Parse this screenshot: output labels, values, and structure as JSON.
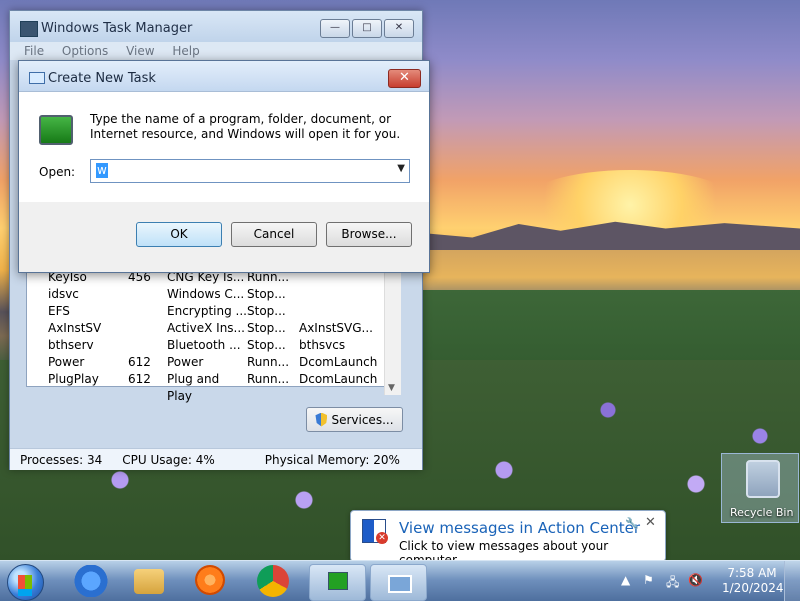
{
  "task_manager": {
    "title": "Windows Task Manager",
    "menu": [
      "File",
      "Options",
      "View",
      "Help"
    ],
    "rows": [
      {
        "name": "KeyIso",
        "pid": "456",
        "description": "CNG Key Is...",
        "status": "Runn...",
        "group": ""
      },
      {
        "name": "idsvc",
        "pid": "",
        "description": "Windows C...",
        "status": "Stop...",
        "group": ""
      },
      {
        "name": "EFS",
        "pid": "",
        "description": "Encrypting ...",
        "status": "Stop...",
        "group": ""
      },
      {
        "name": "AxInstSV",
        "pid": "",
        "description": "ActiveX Ins...",
        "status": "Stop...",
        "group": "AxInstSVG..."
      },
      {
        "name": "bthserv",
        "pid": "",
        "description": "Bluetooth ...",
        "status": "Stop...",
        "group": "bthsvcs"
      },
      {
        "name": "Power",
        "pid": "612",
        "description": "Power",
        "status": "Runn...",
        "group": "DcomLaunch"
      },
      {
        "name": "PlugPlay",
        "pid": "612",
        "description": "Plug and Play",
        "status": "Runn...",
        "group": "DcomLaunch"
      }
    ],
    "services_button": "Services...",
    "status": {
      "processes": "Processes: 34",
      "cpu": "CPU Usage: 4%",
      "memory": "Physical Memory: 20%"
    }
  },
  "dialog": {
    "title": "Create New Task",
    "description": "Type the name of a program, folder, document, or Internet resource, and Windows will open it for you.",
    "open_label": "Open:",
    "open_value": "w",
    "buttons": {
      "ok": "OK",
      "cancel": "Cancel",
      "browse": "Browse..."
    }
  },
  "desktop": {
    "recycle_bin": "Recycle Bin"
  },
  "notification": {
    "title": "View messages in Action Center",
    "message": "Click to view messages about your computer."
  },
  "taskbar": {
    "time": "7:58 AM",
    "date": "1/20/2024"
  }
}
